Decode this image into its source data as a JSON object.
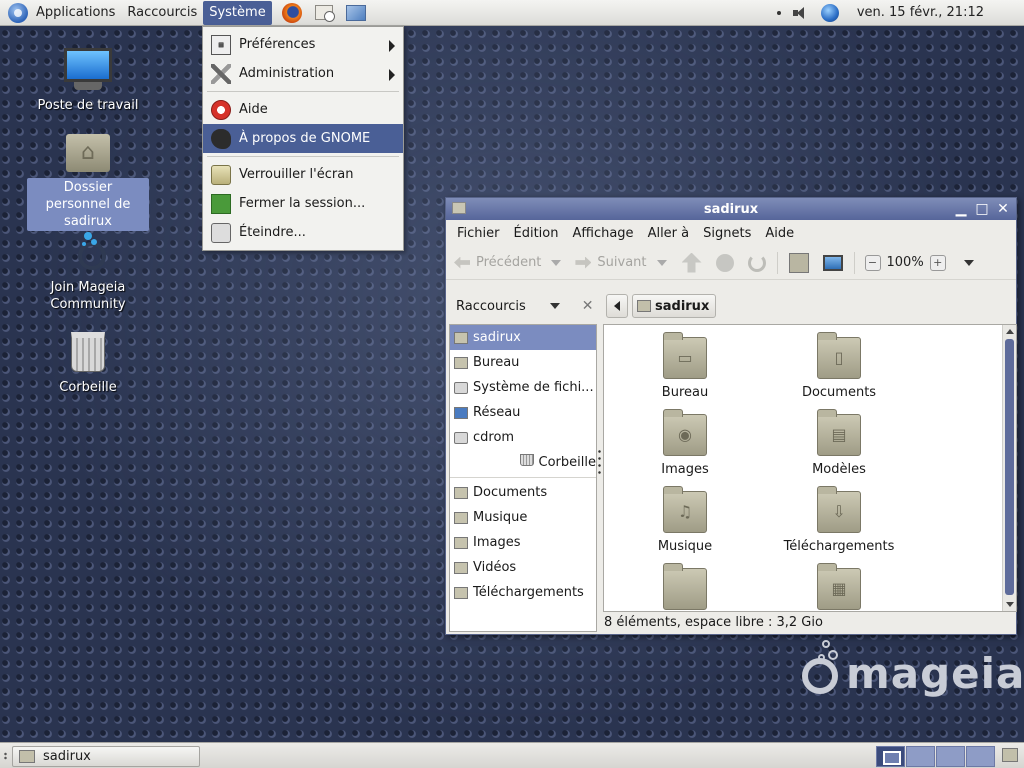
{
  "top_panel": {
    "menus": [
      "Applications",
      "Raccourcis",
      "Système"
    ],
    "active_menu": "Système",
    "clock": "ven. 15 févr., 21:12"
  },
  "system_menu": {
    "items": [
      {
        "label": "Préférences",
        "icon": "preferences-icon",
        "submenu": true
      },
      {
        "label": "Administration",
        "icon": "administration-icon",
        "submenu": true
      },
      {
        "label": "Aide",
        "icon": "help-icon",
        "submenu": false
      },
      {
        "label": "À propos de GNOME",
        "icon": "gnome-foot-icon",
        "submenu": false,
        "highlighted": true
      },
      {
        "label": "Verrouiller l'écran",
        "icon": "lock-screen-icon",
        "submenu": false
      },
      {
        "label": "Fermer la session...",
        "icon": "logout-icon",
        "submenu": false
      },
      {
        "label": "Éteindre...",
        "icon": "shutdown-icon",
        "submenu": false
      }
    ]
  },
  "desktop_icons": [
    {
      "label": "Poste de travail",
      "icon": "computer-icon"
    },
    {
      "label": "Dossier personnel de sadirux",
      "icon": "home-folder-icon",
      "selected": true
    },
    {
      "label": "Join Mageia Community",
      "icon": "mageia-community-icon"
    },
    {
      "label": "Corbeille",
      "icon": "trash-icon"
    }
  ],
  "file_manager": {
    "title": "sadirux",
    "menubar": [
      "Fichier",
      "Édition",
      "Affichage",
      "Aller à",
      "Signets",
      "Aide"
    ],
    "toolbar": {
      "back_label": "Précédent",
      "forward_label": "Suivant",
      "zoom": "100%"
    },
    "side_pane_title": "Raccourcis",
    "path_crumb": "sadirux",
    "sidebar_places": [
      {
        "label": "sadirux",
        "icon": "home-icon",
        "selected": true
      },
      {
        "label": "Bureau",
        "icon": "folder-icon"
      },
      {
        "label": "Système de fichi...",
        "icon": "filesystem-icon"
      },
      {
        "label": "Réseau",
        "icon": "network-icon"
      },
      {
        "label": "cdrom",
        "icon": "cdrom-icon"
      },
      {
        "label": "Corbeille",
        "icon": "trash-icon"
      }
    ],
    "sidebar_bookmarks": [
      {
        "label": "Documents",
        "icon": "folder-icon"
      },
      {
        "label": "Musique",
        "icon": "folder-icon"
      },
      {
        "label": "Images",
        "icon": "folder-icon"
      },
      {
        "label": "Vidéos",
        "icon": "folder-icon"
      },
      {
        "label": "Téléchargements",
        "icon": "folder-icon"
      }
    ],
    "folders": [
      {
        "label": "Bureau",
        "emblem": "desktop-emblem"
      },
      {
        "label": "Documents",
        "emblem": "document-emblem"
      },
      {
        "label": "Images",
        "emblem": "camera-emblem"
      },
      {
        "label": "Modèles",
        "emblem": "template-emblem"
      },
      {
        "label": "Musique",
        "emblem": "music-emblem"
      },
      {
        "label": "Téléchargements",
        "emblem": "download-emblem"
      },
      {
        "label": "",
        "emblem": "none"
      },
      {
        "label": "",
        "emblem": "film-emblem"
      }
    ],
    "status": "8 éléments, espace libre : 3,2 Gio"
  },
  "branding": {
    "word": "mageia"
  },
  "bottom_panel": {
    "task": "sadirux",
    "workspaces": 4,
    "current_workspace": 1
  },
  "colors": {
    "selection": "#4a5f96",
    "title_bar": "#56659a",
    "desktop": "#2a3450"
  }
}
